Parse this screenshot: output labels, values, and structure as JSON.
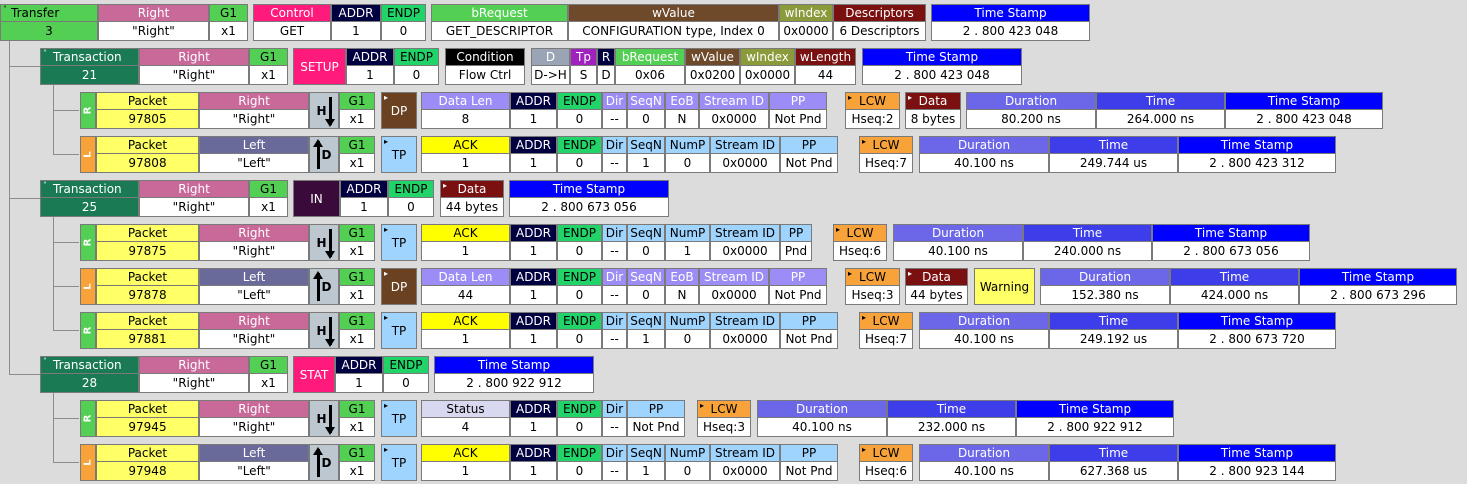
{
  "colors": {
    "green": "#53d053",
    "darkgreen": "#1a7a54",
    "pink": "#c8699a",
    "ctrl": "#ff1a7c",
    "navy": "#000040",
    "endp": "#22d36a",
    "brown": "#6e4a2a",
    "olive": "#8b9a3a",
    "maroon": "#7a1010",
    "blue": "#0000ff",
    "yellow": "#ffff66",
    "lavender": "#9b8df5",
    "slate": "#6a6a9a",
    "orange": "#f7a33a",
    "lightblue": "#9fd4ff",
    "purple": "#a020c0",
    "ack": "#ffff00",
    "dp": "#6a4222"
  },
  "transfer": {
    "label": "Transfer",
    "num": "3",
    "right_h": "Right",
    "right_v": "\"Right\"",
    "g1_h": "G1",
    "g1_v": "x1",
    "control_h": "Control",
    "control_v": "GET",
    "addr_h": "ADDR",
    "addr_v": "1",
    "endp_h": "ENDP",
    "endp_v": "0",
    "breq_h": "bRequest",
    "breq_v": "GET_DESCRIPTOR",
    "wvalue_h": "wValue",
    "wvalue_v": "CONFIGURATION type, Index 0",
    "windex_h": "wIndex",
    "windex_v": "0x0000",
    "desc_h": "Descriptors",
    "desc_v": "6 Descriptors",
    "ts_h": "Time Stamp",
    "ts_v": "2 . 800 423 048"
  },
  "transactions": [
    {
      "label": "Transaction",
      "num": "21",
      "right_h": "Right",
      "right_v": "\"Right\"",
      "g1_h": "G1",
      "g1_v": "x1",
      "type": "SETUP",
      "addr_h": "ADDR",
      "addr_v": "1",
      "endp_h": "ENDP",
      "endp_v": "0",
      "extra": [
        {
          "h": "Condition",
          "v": "Flow Ctrl"
        },
        {
          "h": "D",
          "v": "D->H"
        },
        {
          "h": "Tp",
          "v": "S"
        },
        {
          "h": "R",
          "v": "D"
        },
        {
          "h": "bRequest",
          "v": "0x06"
        },
        {
          "h": "wValue",
          "v": "0x0200"
        },
        {
          "h": "wIndex",
          "v": "0x0000"
        },
        {
          "h": "wLength",
          "v": "44"
        }
      ],
      "ts_h": "Time Stamp",
      "ts_v": "2 . 800 423 048"
    },
    {
      "label": "Transaction",
      "num": "25",
      "right_h": "Right",
      "right_v": "\"Right\"",
      "g1_h": "G1",
      "g1_v": "x1",
      "type": "IN",
      "addr_h": "ADDR",
      "addr_v": "1",
      "endp_h": "ENDP",
      "endp_v": "0",
      "data_h": "Data",
      "data_v": "44 bytes",
      "ts_h": "Time Stamp",
      "ts_v": "2 . 800 673 056"
    },
    {
      "label": "Transaction",
      "num": "28",
      "right_h": "Right",
      "right_v": "\"Right\"",
      "g1_h": "G1",
      "g1_v": "x1",
      "type": "STAT",
      "addr_h": "ADDR",
      "addr_v": "1",
      "endp_h": "ENDP",
      "endp_v": "0",
      "ts_h": "Time Stamp",
      "ts_v": "2 . 800 922 912"
    }
  ],
  "packets": [
    {
      "side": "R",
      "pkt_h": "Packet",
      "pkt_v": "97805",
      "dir_h": "Right",
      "dir_v": "\"Right\"",
      "g1_h": "G1",
      "g1_v": "x1",
      "type": "DP",
      "fields": [
        {
          "h": "Data Len",
          "v": "8"
        },
        {
          "h": "ADDR",
          "v": "1"
        },
        {
          "h": "ENDP",
          "v": "0"
        },
        {
          "h": "Dir",
          "v": "--"
        },
        {
          "h": "SeqN",
          "v": "0"
        },
        {
          "h": "EoB",
          "v": "N"
        },
        {
          "h": "Stream ID",
          "v": "0x0000"
        },
        {
          "h": "PP",
          "v": "Not Pnd"
        }
      ],
      "lcw_h": "LCW",
      "lcw_v": "Hseq:2",
      "data_h": "Data",
      "data_v": "8 bytes",
      "dur_h": "Duration",
      "dur_v": "80.200 ns",
      "time_h": "Time",
      "time_v": "264.000 ns",
      "ts_h": "Time Stamp",
      "ts_v": "2 . 800 423 048"
    },
    {
      "side": "L",
      "pkt_h": "Packet",
      "pkt_v": "97808",
      "dir_h": "Left",
      "dir_v": "\"Left\"",
      "g1_h": "G1",
      "g1_v": "x1",
      "type": "TP",
      "fields": [
        {
          "h": "ACK",
          "v": "1"
        },
        {
          "h": "ADDR",
          "v": "1"
        },
        {
          "h": "ENDP",
          "v": "0"
        },
        {
          "h": "Dir",
          "v": "--"
        },
        {
          "h": "SeqN",
          "v": "1"
        },
        {
          "h": "NumP",
          "v": "0"
        },
        {
          "h": "Stream ID",
          "v": "0x0000"
        },
        {
          "h": "PP",
          "v": "Not Pnd"
        }
      ],
      "lcw_h": "LCW",
      "lcw_v": "Hseq:7",
      "dur_h": "Duration",
      "dur_v": "40.100 ns",
      "time_h": "Time",
      "time_v": "249.744 us",
      "ts_h": "Time Stamp",
      "ts_v": "2 . 800 423 312"
    },
    {
      "side": "R",
      "pkt_h": "Packet",
      "pkt_v": "97875",
      "dir_h": "Right",
      "dir_v": "\"Right\"",
      "g1_h": "G1",
      "g1_v": "x1",
      "type": "TP",
      "fields": [
        {
          "h": "ACK",
          "v": "1"
        },
        {
          "h": "ADDR",
          "v": "1"
        },
        {
          "h": "ENDP",
          "v": "0"
        },
        {
          "h": "Dir",
          "v": "--"
        },
        {
          "h": "SeqN",
          "v": "0"
        },
        {
          "h": "NumP",
          "v": "1"
        },
        {
          "h": "Stream ID",
          "v": "0x0000"
        },
        {
          "h": "PP",
          "v": "Pnd"
        }
      ],
      "lcw_h": "LCW",
      "lcw_v": "Hseq:6",
      "dur_h": "Duration",
      "dur_v": "40.100 ns",
      "time_h": "Time",
      "time_v": "240.000 ns",
      "ts_h": "Time Stamp",
      "ts_v": "2 . 800 673 056"
    },
    {
      "side": "L",
      "pkt_h": "Packet",
      "pkt_v": "97878",
      "dir_h": "Left",
      "dir_v": "\"Left\"",
      "g1_h": "G1",
      "g1_v": "x1",
      "type": "DP",
      "fields": [
        {
          "h": "Data Len",
          "v": "44"
        },
        {
          "h": "ADDR",
          "v": "1"
        },
        {
          "h": "ENDP",
          "v": "0"
        },
        {
          "h": "Dir",
          "v": "--"
        },
        {
          "h": "SeqN",
          "v": "0"
        },
        {
          "h": "EoB",
          "v": "N"
        },
        {
          "h": "Stream ID",
          "v": "0x0000"
        },
        {
          "h": "PP",
          "v": "Not Pnd"
        }
      ],
      "lcw_h": "LCW",
      "lcw_v": "Hseq:3",
      "data_h": "Data",
      "data_v": "44 bytes",
      "warning": "Warning",
      "dur_h": "Duration",
      "dur_v": "152.380 ns",
      "time_h": "Time",
      "time_v": "424.000 ns",
      "ts_h": "Time Stamp",
      "ts_v": "2 . 800 673 296"
    },
    {
      "side": "R",
      "pkt_h": "Packet",
      "pkt_v": "97881",
      "dir_h": "Right",
      "dir_v": "\"Right\"",
      "g1_h": "G1",
      "g1_v": "x1",
      "type": "TP",
      "fields": [
        {
          "h": "ACK",
          "v": "1"
        },
        {
          "h": "ADDR",
          "v": "1"
        },
        {
          "h": "ENDP",
          "v": "0"
        },
        {
          "h": "Dir",
          "v": "--"
        },
        {
          "h": "SeqN",
          "v": "1"
        },
        {
          "h": "NumP",
          "v": "0"
        },
        {
          "h": "Stream ID",
          "v": "0x0000"
        },
        {
          "h": "PP",
          "v": "Not Pnd"
        }
      ],
      "lcw_h": "LCW",
      "lcw_v": "Hseq:7",
      "dur_h": "Duration",
      "dur_v": "40.100 ns",
      "time_h": "Time",
      "time_v": "249.192 us",
      "ts_h": "Time Stamp",
      "ts_v": "2 . 800 673 720"
    },
    {
      "side": "R",
      "pkt_h": "Packet",
      "pkt_v": "97945",
      "dir_h": "Right",
      "dir_v": "\"Right\"",
      "g1_h": "G1",
      "g1_v": "x1",
      "type": "TP",
      "fields": [
        {
          "h": "Status",
          "v": "4"
        },
        {
          "h": "ADDR",
          "v": "1"
        },
        {
          "h": "ENDP",
          "v": "0"
        },
        {
          "h": "Dir",
          "v": "--"
        },
        {
          "h": "PP",
          "v": "Not Pnd"
        }
      ],
      "lcw_h": "LCW",
      "lcw_v": "Hseq:3",
      "dur_h": "Duration",
      "dur_v": "40.100 ns",
      "time_h": "Time",
      "time_v": "232.000 ns",
      "ts_h": "Time Stamp",
      "ts_v": "2 . 800 922 912"
    },
    {
      "side": "L",
      "pkt_h": "Packet",
      "pkt_v": "97948",
      "dir_h": "Left",
      "dir_v": "\"Left\"",
      "g1_h": "G1",
      "g1_v": "x1",
      "type": "TP",
      "fields": [
        {
          "h": "ACK",
          "v": "1"
        },
        {
          "h": "ADDR",
          "v": "1"
        },
        {
          "h": "ENDP",
          "v": "0"
        },
        {
          "h": "Dir",
          "v": "--"
        },
        {
          "h": "SeqN",
          "v": "1"
        },
        {
          "h": "NumP",
          "v": "0"
        },
        {
          "h": "Stream ID",
          "v": "0x0000"
        },
        {
          "h": "PP",
          "v": "Not Pnd"
        }
      ],
      "lcw_h": "LCW",
      "lcw_v": "Hseq:6",
      "dur_h": "Duration",
      "dur_v": "40.100 ns",
      "time_h": "Time",
      "time_v": "627.368 us",
      "ts_h": "Time Stamp",
      "ts_v": "2 . 800 923 144"
    }
  ]
}
